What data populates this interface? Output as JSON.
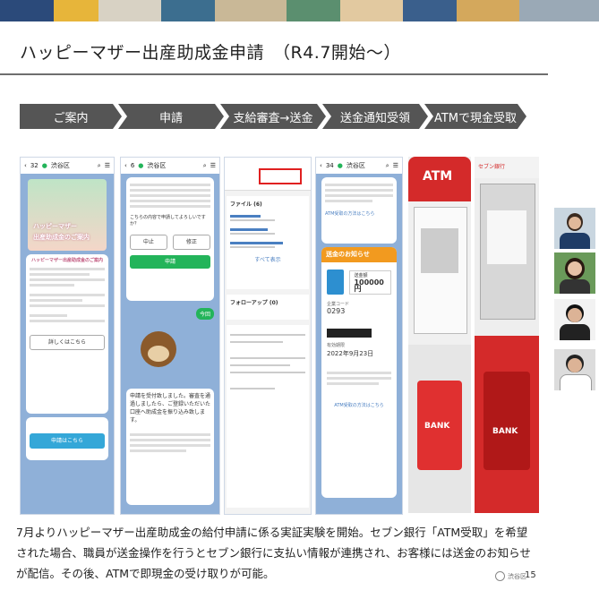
{
  "slide": {
    "title": "ハッピーマザー出産助成金申請　（R4.7開始～）",
    "steps": [
      "ご案内",
      "申請",
      "支給審査→送金",
      "送金通知受領",
      "ATMで現金受取"
    ],
    "caption": "7月よりハッピーマザー出産助成金の給付申請に係る実証実験を開始。セブン銀行「ATM受取」を希望された場合、職員が送金操作を行うとセブン銀行に支払い情報が連携され、お客様には送金のお知らせが配信。その後、ATMで即現金の受け取りが可能。",
    "page_number": "15",
    "footer_logo_text": "渋谷区"
  },
  "phone1": {
    "back_count": "32",
    "account": "渋谷区",
    "banner_title_1": "ハッピーマザー",
    "banner_title_2": "出産助成金のご案内",
    "intro_heading": "ハッピーマザー出産助成金のご案内",
    "link_label": "詳しくはこちら",
    "apply_label": "申請はこちら"
  },
  "phone2": {
    "back_count": "6",
    "account": "渋谷区",
    "confirm_text": "こちらの内容で申請してよろしいですか？",
    "cancel_label": "中止",
    "fix_label": "修正",
    "submit_label": "申請",
    "done_text": "申請を受付致しました。審査を通過しましたら、ご登録いただいた口座へ助成金を振り込み致します。"
  },
  "phone3": {
    "file_section": "ファイル (6)",
    "followup_section": "フォローアップ (0)",
    "show_all": "すべて表示"
  },
  "phone4": {
    "back_count": "34",
    "account": "渋谷区",
    "notice_title": "送金のお知らせ",
    "amount_label": "送金額",
    "amount": "100000円",
    "company_code_label": "企業コード",
    "company_code": "0293",
    "date_label": "有効期限",
    "date_value": "2022年9月23日",
    "atm_link": "ATM受取の方法はこちら"
  },
  "atm": {
    "brand_label": "ATM",
    "bank_label": "BANK",
    "seven_label": "セブン銀行"
  },
  "participants": [
    {
      "name": "participant-1"
    },
    {
      "name": "participant-2"
    },
    {
      "name": "participant-3"
    },
    {
      "name": "participant-4"
    }
  ]
}
